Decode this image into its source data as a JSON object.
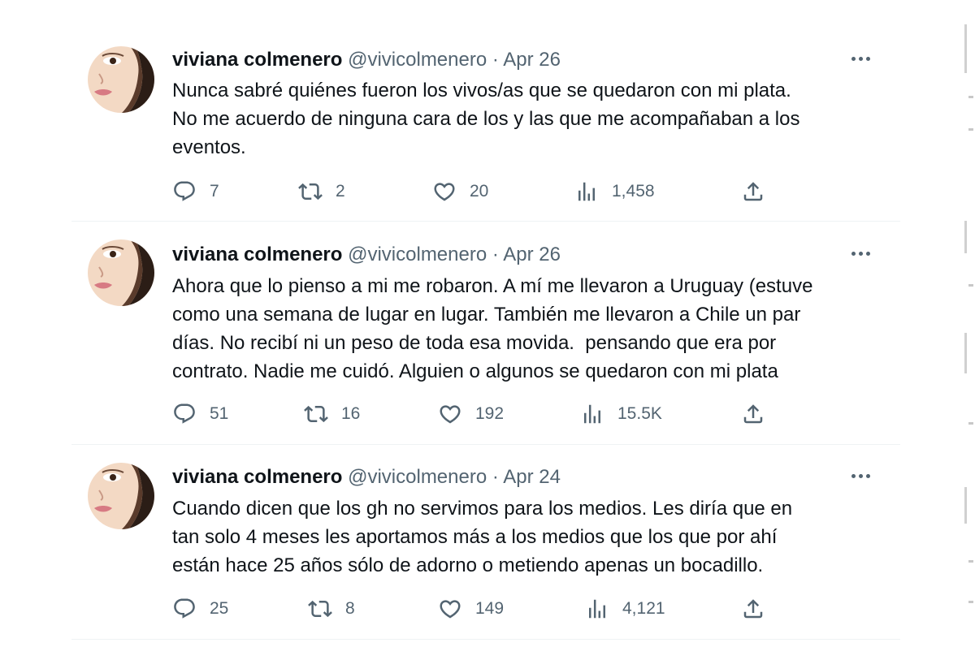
{
  "tweets": [
    {
      "name": "viviana colmenero",
      "handle": "@vivicolmenero",
      "separator": "·",
      "date": "Apr 26",
      "text": "Nunca sabré quiénes fueron los vivos/as que se quedaron con mi plata.\nNo me acuerdo de ninguna cara de los y las que me acompañaban a los\neventos.",
      "replies": "7",
      "retweets": "2",
      "likes": "20",
      "views": "1,458"
    },
    {
      "name": "viviana colmenero",
      "handle": "@vivicolmenero",
      "separator": "·",
      "date": "Apr 26",
      "text": "Ahora que lo pienso a mi me robaron. A mí me llevaron a Uruguay (estuve\ncomo una semana de lugar en lugar. También me llevaron a Chile un par\ndías. No recibí ni un peso de toda esa movida.  pensando que era por\ncontrato. Nadie me cuidó. Alguien o algunos se quedaron con mi plata",
      "replies": "51",
      "retweets": "16",
      "likes": "192",
      "views": "15.5K"
    },
    {
      "name": "viviana colmenero",
      "handle": "@vivicolmenero",
      "separator": "·",
      "date": "Apr 24",
      "text": "Cuando dicen que los gh no servimos para los medios. Les diría que en\ntan solo 4 meses les aportamos más a los medios que los que por ahí\nestán hace 25 años sólo de adorno o metiendo apenas un bocadillo.",
      "replies": "25",
      "retweets": "8",
      "likes": "149",
      "views": "4,121"
    }
  ],
  "icons": {
    "reply": "reply-icon",
    "retweet": "retweet-icon",
    "like": "heart-icon",
    "views": "views-icon",
    "share": "share-icon",
    "more": "more-icon"
  },
  "colors": {
    "text": "#0f1419",
    "secondary": "#536471",
    "divider": "#eff3f4"
  }
}
